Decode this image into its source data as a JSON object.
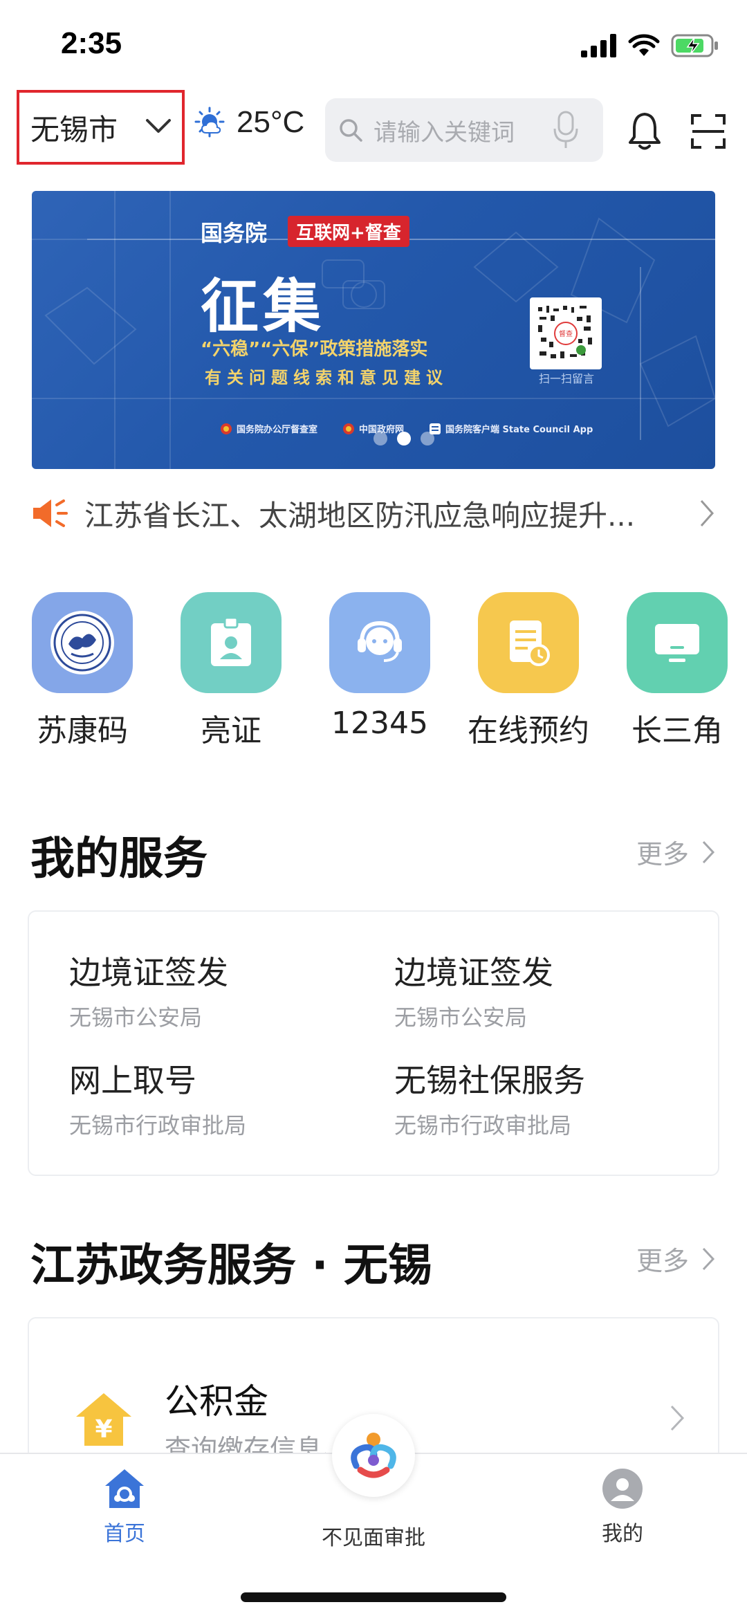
{
  "status_bar": {
    "time": "2:35"
  },
  "header": {
    "city": "无锡市",
    "temperature": "25°C",
    "search_placeholder": "请输入关键词"
  },
  "banner": {
    "org": "国务院",
    "tag": "互联网+督查",
    "headline": "征集",
    "line1": "“六稳”“六保”政策措施落实",
    "line2": "有关问题线索和意见建议",
    "qr_caption": "扫一扫留言",
    "footer": [
      "国务院办公厅督查室",
      "中国政府网",
      "国务院客户端 State Council App"
    ],
    "active_slide": 2,
    "slide_count": 3
  },
  "notice": {
    "text": "江苏省长江、太湖地区防汛应急响应提升..."
  },
  "quick_actions": [
    {
      "label": "苏康码",
      "icon": "health-code-icon",
      "color": "#7fa3e6"
    },
    {
      "label": "亮证",
      "icon": "id-badge-icon",
      "color": "#6fcdc2"
    },
    {
      "label": "12345",
      "icon": "hotline-headset-icon",
      "color": "#86aeea"
    },
    {
      "label": "在线预约",
      "icon": "appointment-icon",
      "color": "#f6c64a"
    },
    {
      "label": "长三角",
      "icon": "monitor-icon",
      "color": "#5fcfae"
    }
  ],
  "my_services": {
    "title": "我的服务",
    "more": "更多",
    "items": [
      {
        "title": "边境证签发",
        "dept": "无锡市公安局"
      },
      {
        "title": "边境证签发",
        "dept": "无锡市公安局"
      },
      {
        "title": "网上取号",
        "dept": "无锡市行政审批局"
      },
      {
        "title": "无锡社保服务",
        "dept": "无锡市行政审批局"
      }
    ]
  },
  "gov_services": {
    "title": "江苏政务服务 · 无锡",
    "more": "更多",
    "card": {
      "title": "公积金",
      "subtitle": "查询缴存信息、预约"
    }
  },
  "bottom_nav": {
    "items": [
      {
        "label": "首页",
        "icon": "home-icon",
        "active": true
      },
      {
        "label": "不见面审批",
        "icon": "app-logo-icon",
        "active": false
      },
      {
        "label": "我的",
        "icon": "profile-icon",
        "active": false
      }
    ],
    "active_color": "#3b74d8"
  }
}
